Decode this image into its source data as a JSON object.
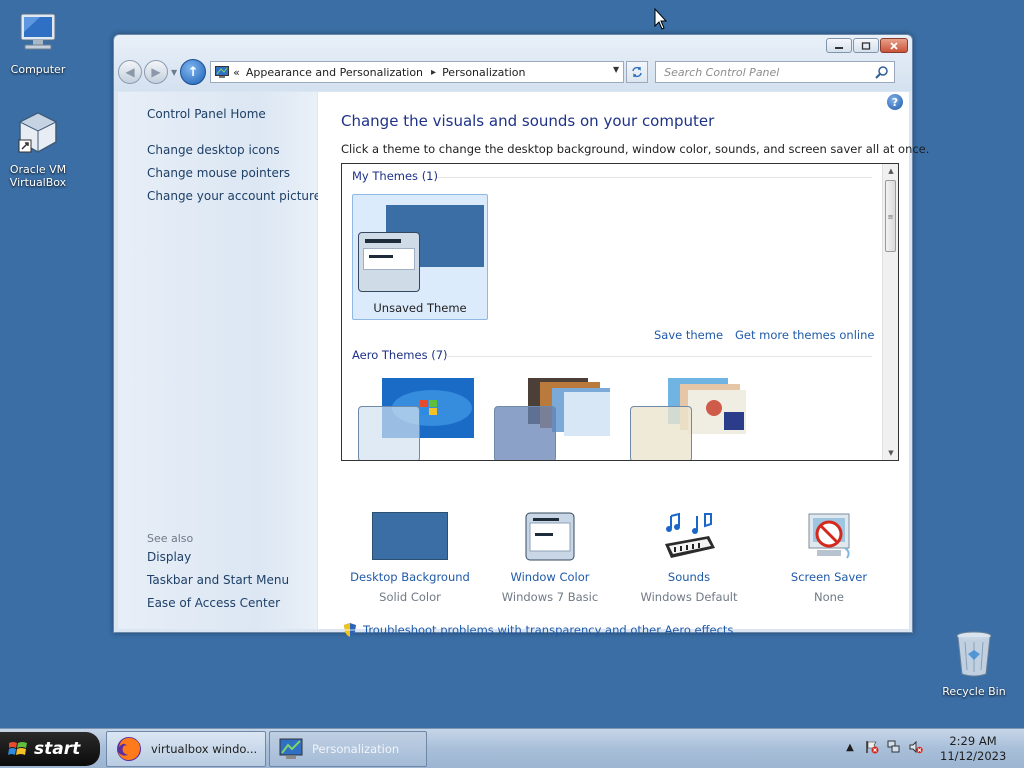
{
  "desktop": {
    "icons": [
      {
        "label": "Computer"
      },
      {
        "label": "Oracle VM\nVirtualBox",
        "line1": "Oracle VM",
        "line2": "VirtualBox"
      },
      {
        "label": "Recycle Bin"
      }
    ]
  },
  "window": {
    "address": {
      "breadcrumb": [
        "Appearance and Personalization",
        "Personalization"
      ],
      "overflow": "«"
    },
    "search": {
      "placeholder": "Search Control Panel"
    },
    "left_pane": {
      "home": "Control Panel Home",
      "links": [
        "Change desktop icons",
        "Change mouse pointers",
        "Change your account picture"
      ],
      "see_also_title": "See also",
      "see_also": [
        "Display",
        "Taskbar and Start Menu",
        "Ease of Access Center"
      ]
    },
    "main": {
      "heading": "Change the visuals and sounds on your computer",
      "subtext": "Click a theme to change the desktop background, window color, sounds, and screen saver all at once.",
      "my_themes_label": "My Themes (1)",
      "selected_theme": "Unsaved Theme",
      "save_theme": "Save theme",
      "get_more": "Get more themes online",
      "aero_themes_label": "Aero Themes (7)",
      "bottom_items": [
        {
          "title": "Desktop Background",
          "sub": "Solid Color"
        },
        {
          "title": "Window Color",
          "sub": "Windows 7 Basic"
        },
        {
          "title": "Sounds",
          "sub": "Windows Default"
        },
        {
          "title": "Screen Saver",
          "sub": "None"
        }
      ],
      "troubleshoot": "Troubleshoot problems with transparency and other Aero effects"
    }
  },
  "taskbar": {
    "start": "start",
    "tasks": [
      {
        "label": "virtualbox windo..."
      },
      {
        "label": "Personalization"
      }
    ],
    "clock": {
      "time": "2:29 AM",
      "date": "11/12/2023"
    }
  },
  "colors": {
    "desktop": "#3a6ea5",
    "link": "#1f5aa8",
    "heading": "#1e3287"
  }
}
